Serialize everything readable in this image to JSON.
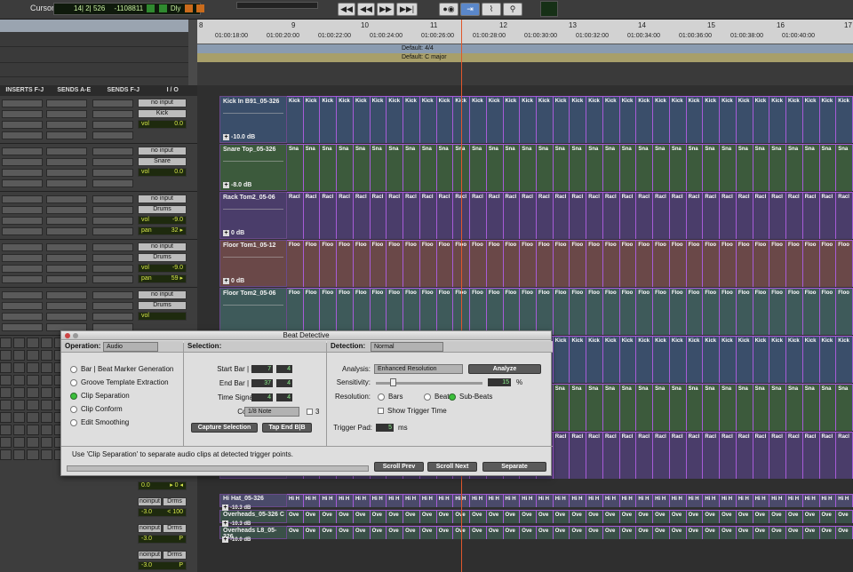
{
  "toolbar": {
    "cursor_label": "Cursor",
    "counter_main": "14| 2| 526",
    "counter_sub": "-1108811",
    "counter_flag": "Dly",
    "transport": [
      "◀◀",
      "◀◀",
      "▶▶",
      "▶▶|",
      "●◉",
      "⇥",
      "⌇",
      "⚲"
    ]
  },
  "columns": [
    "INSERTS F-J",
    "SENDS A-E",
    "SENDS F-J",
    "I / O"
  ],
  "ruler": {
    "bars": [
      "8",
      "9",
      "10",
      "11",
      "12",
      "13",
      "14",
      "15",
      "16",
      "17"
    ],
    "timecodes": [
      "01:00:18:00",
      "01:00:20:00",
      "01:00:22:00",
      "01:00:24:00",
      "01:00:26:00",
      "01:00:28:00",
      "01:00:30:00",
      "01:00:32:00",
      "01:00:34:00",
      "01:00:36:00",
      "01:00:38:00",
      "01:00:40:00"
    ],
    "meter": "Default: 4/4",
    "key": "Default: C major"
  },
  "io_strips": [
    {
      "input": "no input",
      "bus": "Kick",
      "vol_label": "vol",
      "vol": "0.0",
      "pan_label": "",
      "pan": ""
    },
    {
      "input": "no input",
      "bus": "Snare",
      "vol_label": "vol",
      "vol": "0.0",
      "pan_label": "",
      "pan": ""
    },
    {
      "input": "no input",
      "bus": "Drums",
      "vol_label": "vol",
      "vol": "-9.0",
      "pan_label": "pan",
      "pan": "32 ▸"
    },
    {
      "input": "no input",
      "bus": "Drums",
      "vol_label": "vol",
      "vol": "-9.0",
      "pan_label": "pan",
      "pan": "59 ▸"
    },
    {
      "input": "no input",
      "bus": "Drums",
      "vol_label": "vol",
      "vol": "",
      "pan_label": "",
      "pan": ""
    }
  ],
  "io_lower": [
    {
      "a": "0.0",
      "b": "▸ 0 ◂"
    },
    {
      "a": "noinput",
      "b": "Drms",
      "c": "-3.0",
      "d": "< 100"
    },
    {
      "a": "noinput",
      "b": "Drms",
      "c": "-3.0",
      "d": "P"
    },
    {
      "a": "noinput",
      "b": "Drms",
      "c": "-3.0",
      "d": "P"
    }
  ],
  "tracks": [
    {
      "name": "Kick In B91_05-326",
      "gain": "-10.0 dB",
      "clip": "Kick",
      "color": "#3a4e6a"
    },
    {
      "name": "Snare Top_05-326",
      "gain": "-8.0 dB",
      "clip": "Sna",
      "color": "#3c5a3c"
    },
    {
      "name": "Rack Tom2_05-06",
      "gain": "0 dB",
      "clip": "Racl",
      "color": "#4a3d6a"
    },
    {
      "name": "Floor Tom1_05-12",
      "gain": "0 dB",
      "clip": "Floo",
      "color": "#6a4848"
    },
    {
      "name": "Floor Tom2_05-06",
      "gain": "",
      "clip": "Floo",
      "color": "#3e5a5a"
    }
  ],
  "lower_tracks": [
    {
      "name": "Hi Hat_05-326",
      "gain": "-10.3 dB",
      "clip": "Hi H",
      "color": "#4a4a6a"
    },
    {
      "name": "Overheads_05-326 C",
      "gain": "-10.3 dB",
      "clip": "Ove",
      "color": "#3a5048"
    },
    {
      "name": "Overheads L8_05-326",
      "gain": "-10.0 dB",
      "clip": "Ove",
      "color": "#3a5048"
    }
  ],
  "dialog": {
    "title": "Beat Detective",
    "operation_label": "Operation:",
    "operation_value": "Audio",
    "operations": [
      "Bar | Beat Marker Generation",
      "Groove Template Extraction",
      "Clip Separation",
      "Clip Conform",
      "Edit Smoothing"
    ],
    "selected_operation": 2,
    "selection_label": "Selection:",
    "start_label": "Start Bar | Beat:",
    "start_bar": "7",
    "start_beat": "4",
    "end_label": "End Bar | Beat:",
    "end_bar": "37",
    "end_beat": "4",
    "timesig_label": "Time Signature:",
    "ts_num": "4",
    "ts_den": "4",
    "contains_label": "Contains:",
    "contains_value": "1/8 Note",
    "triplet": "3",
    "capture_btn": "Capture Selection",
    "tapend_btn": "Tap End B|B",
    "detection_label": "Detection:",
    "detection_value": "Normal",
    "analysis_label": "Analysis:",
    "analysis_value": "Enhanced Resolution",
    "analyze_btn": "Analyze",
    "sensitivity_label": "Sensitivity:",
    "sensitivity_value": "15",
    "sensitivity_unit": "%",
    "resolution_label": "Resolution:",
    "res_options": [
      "Bars",
      "Beats",
      "Sub-Beats"
    ],
    "res_selected": 2,
    "show_trigger": "Show Trigger Time",
    "trigger_pad_label": "Trigger Pad:",
    "trigger_pad_value": "5",
    "trigger_pad_unit": "ms",
    "help_text": "Use 'Clip Separation' to separate audio clips at detected trigger points.",
    "scroll_prev": "Scroll Prev",
    "scroll_next": "Scroll Next",
    "separate": "Separate"
  }
}
